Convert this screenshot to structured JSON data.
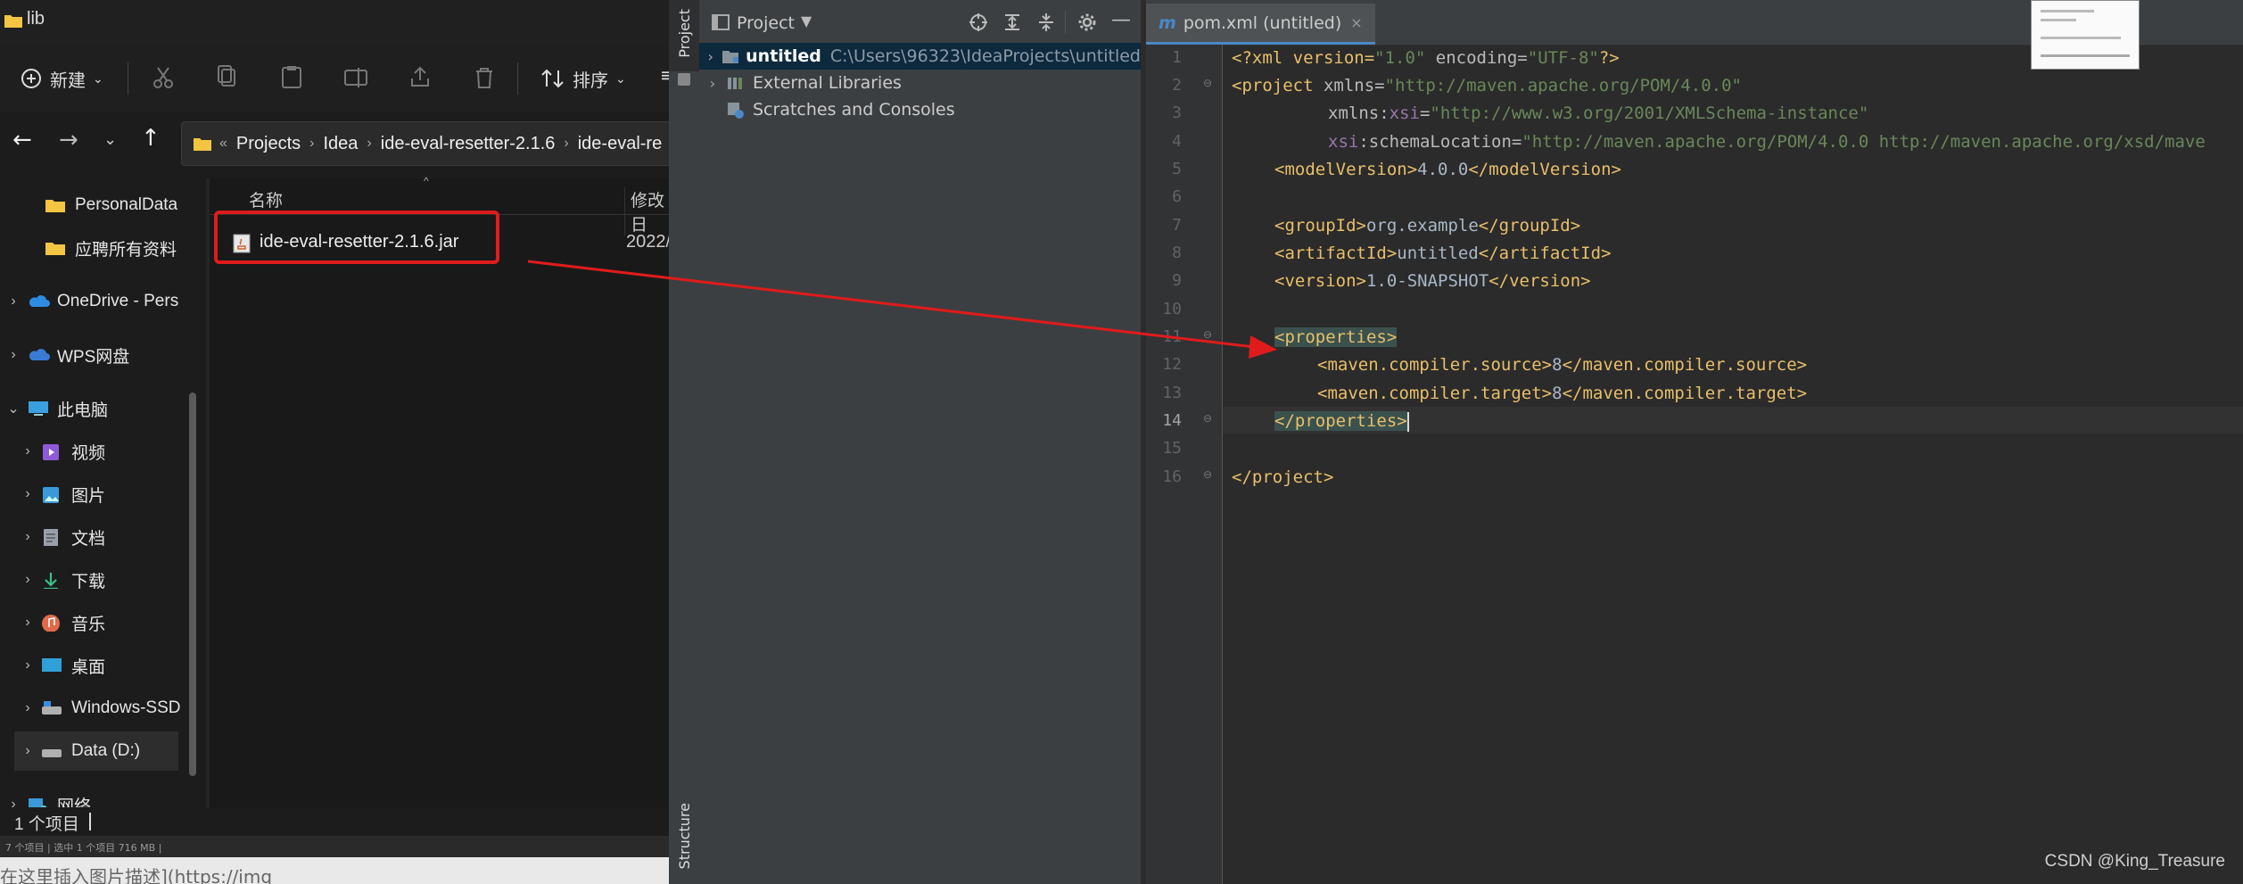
{
  "explorer": {
    "title": "lib",
    "toolbar": {
      "new_label": "新建",
      "sort_label": "排序"
    },
    "address": {
      "crumbs": [
        "Projects",
        "Idea",
        "ide-eval-resetter-2.1.6",
        "ide-eval-re"
      ],
      "overflow": "«"
    },
    "nav_items": [
      {
        "label": "PersonalData",
        "icon": "folder-icon",
        "color": "#f4c542"
      },
      {
        "label": "应聘所有资料",
        "icon": "folder-icon",
        "color": "#f4c542"
      },
      {
        "label": "OneDrive - Pers",
        "icon": "onedrive-icon",
        "color": "#2d8ce0"
      },
      {
        "label": "WPS网盘",
        "icon": "wps-cloud-icon",
        "color": "#3a7bd5"
      },
      {
        "label": "此电脑",
        "icon": "computer-icon",
        "color": "#3aa0e0"
      },
      {
        "label": "视频",
        "icon": "video-icon",
        "color": "#8e5ad8"
      },
      {
        "label": "图片",
        "icon": "pictures-icon",
        "color": "#3a9ad8"
      },
      {
        "label": "文档",
        "icon": "documents-icon",
        "color": "#9aa0aa"
      },
      {
        "label": "下载",
        "icon": "download-icon",
        "color": "#3ac08a"
      },
      {
        "label": "音乐",
        "icon": "music-icon",
        "color": "#e06a4a"
      },
      {
        "label": "桌面",
        "icon": "desktop-icon",
        "color": "#2fa0d8"
      },
      {
        "label": "Windows-SSD",
        "icon": "drive-icon",
        "color": "#b0b0b0"
      },
      {
        "label": "Data (D:)",
        "icon": "drive-icon",
        "color": "#b0b0b0"
      },
      {
        "label": "网络",
        "icon": "network-icon",
        "color": "#3a9ad8"
      }
    ],
    "columns": {
      "name": "名称",
      "modified": "修改日"
    },
    "file": {
      "name": "ide-eval-resetter-2.1.6.jar",
      "date": "2022/"
    },
    "status": "1 个项目",
    "status_small": "7 个项目 | 选中 1 个项目 716 MB |",
    "bg_text": "在这里插入图片描述](https://img"
  },
  "ide": {
    "strip_project": "Project",
    "strip_structure": "Structure",
    "panel_title": "Project",
    "tree": [
      {
        "label": "untitled",
        "path": "C:\\Users\\96323\\IdeaProjects\\untitled"
      },
      {
        "label": "External Libraries"
      },
      {
        "label": "Scratches and Consoles"
      }
    ],
    "tab_label": "pom.xml (untitled)",
    "tab_icon": "m",
    "lines": [
      "1",
      "2",
      "3",
      "4",
      "5",
      "6",
      "7",
      "8",
      "9",
      "10",
      "11",
      "12",
      "13",
      "14",
      "15",
      "16"
    ],
    "code": {
      "l1_a": "<?xml version=",
      "l1_b": "\"1.0\"",
      "l1_c": " encoding=",
      "l1_d": "\"UTF-8\"",
      "l1_e": "?>",
      "l2_a": "<project",
      "l2_b": " xmlns=",
      "l2_c": "\"http://maven.apache.org/POM/4.0.0\"",
      "l3_a": "xmlns:",
      "l3_b": "xsi",
      "l3_c": "=",
      "l3_d": "\"http://www.w3.org/2001/XMLSchema-instance\"",
      "l4_a": "xsi",
      "l4_b": ":schemaLocation=",
      "l4_c": "\"http://maven.apache.org/POM/4.0.0 http://maven.apache.org/xsd/mave",
      "l5_a": "<modelVersion>",
      "l5_b": "4.0.0",
      "l5_c": "</modelVersion>",
      "l7_a": "<groupId>",
      "l7_b": "org.example",
      "l7_c": "</groupId>",
      "l8_a": "<artifactId>",
      "l8_b": "untitled",
      "l8_c": "</artifactId>",
      "l9_a": "<version>",
      "l9_b": "1.0-SNAPSHOT",
      "l9_c": "</version>",
      "l11": "<properties>",
      "l12_a": "<maven.compiler.source>",
      "l12_b": "8",
      "l12_c": "</maven.compiler.source>",
      "l13_a": "<maven.compiler.target>",
      "l13_b": "8",
      "l13_c": "</maven.compiler.target>",
      "l14": "</properties>",
      "l16": "</project>"
    },
    "watermark": "CSDN @King_Treasure"
  },
  "colors": {
    "annotation_red": "#e01b1b",
    "ide_bg": "#2b2b2b",
    "xml_tag": "#e8bf6a",
    "xml_value": "#6a8759"
  }
}
